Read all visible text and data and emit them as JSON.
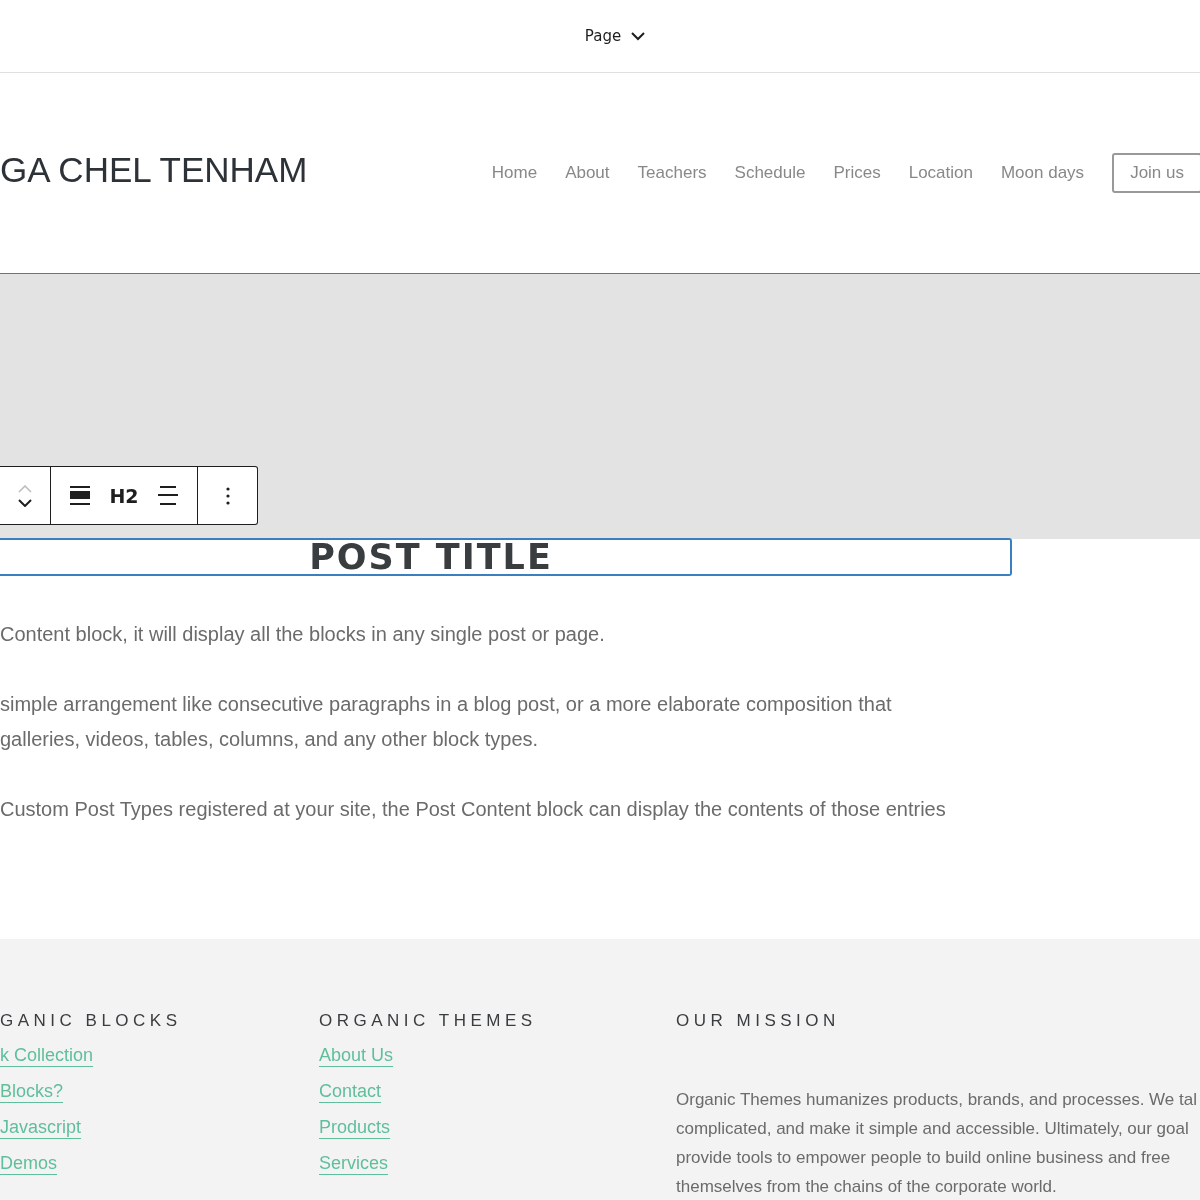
{
  "top_bar": {
    "document_menu": "Page"
  },
  "site_header": {
    "site_title": "GA CHEL TENHAM",
    "nav_items": [
      "Home",
      "About",
      "Teachers",
      "Schedule",
      "Prices",
      "Location",
      "Moon days"
    ],
    "cta_button": "Join us"
  },
  "block_toolbar": {
    "heading_level": "H2"
  },
  "post_title": "POST TITLE",
  "content_paragraphs": [
    {
      "lines": [
        "Content block, it will display all the blocks in any single post or page."
      ]
    },
    {
      "lines": [
        " simple arrangement like consecutive paragraphs in a blog post, or a more elaborate composition that",
        "galleries, videos, tables, columns, and any other block types."
      ]
    },
    {
      "lines": [
        "Custom Post Types registered at your site, the Post Content block can display the contents of those entries"
      ]
    }
  ],
  "footer": {
    "columns": [
      {
        "heading": "GANIC BLOCKS",
        "links": [
          "k Collection",
          "Blocks?",
          "Javascript",
          " Demos"
        ]
      },
      {
        "heading": "ORGANIC THEMES",
        "links": [
          "About Us",
          "Contact",
          "Products",
          "Services"
        ]
      }
    ],
    "mission": {
      "heading": "OUR MISSION",
      "lines": [
        "Organic Themes humanizes products, brands, and processes. We tal",
        "complicated, and make it simple and accessible. Ultimately, our goal",
        "provide tools to empower people to build online business and free",
        "themselves from the chains of the corporate world."
      ]
    }
  }
}
